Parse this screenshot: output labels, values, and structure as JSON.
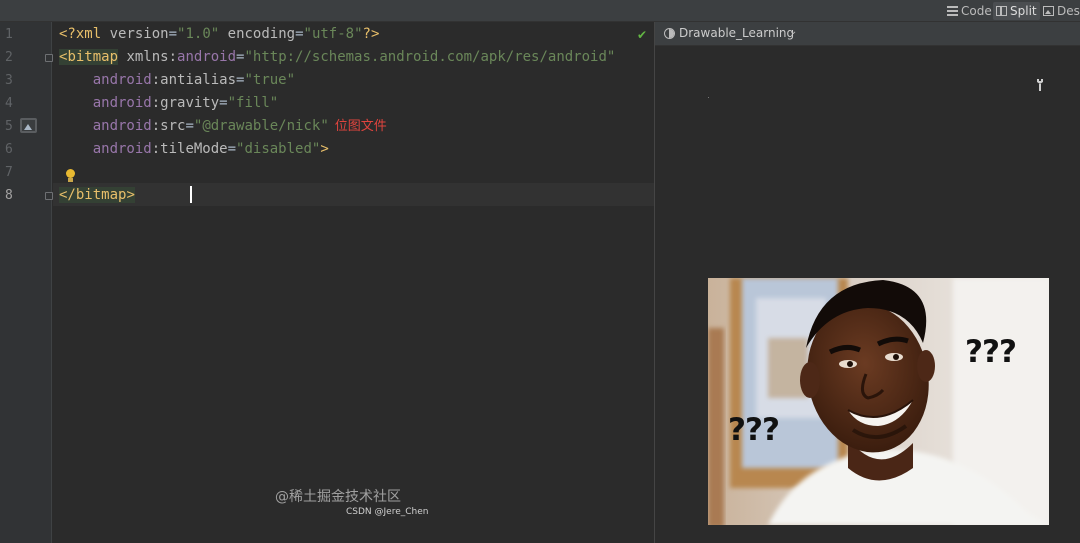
{
  "toolbar": {
    "code_label": "Code",
    "split_label": "Split",
    "design_label": "Desi",
    "active_view": "Split"
  },
  "gutter": {
    "line_numbers": [
      "1",
      "2",
      "3",
      "4",
      "5",
      "6",
      "7",
      "8"
    ],
    "current_line": "8"
  },
  "editor": {
    "line1": {
      "pi_open": "<?",
      "name": "xml",
      "attr1": "version",
      "eq": "=",
      "val1": "\"1.0\"",
      "attr2": "encoding",
      "val2": "\"utf-8\"",
      "pi_close": "?>"
    },
    "line2": {
      "open": "<",
      "tag": "bitmap",
      "attr": "xmlns:",
      "ns": "android",
      "eq": "=",
      "val": "\"http://schemas.android.com/apk/res/android\""
    },
    "line3": {
      "ns": "android",
      "attr": ":antialias",
      "eq": "=",
      "val": "\"true\""
    },
    "line4": {
      "ns": "android",
      "attr": ":gravity",
      "eq": "=",
      "val": "\"fill\""
    },
    "line5": {
      "ns": "android",
      "attr": ":src",
      "eq": "=",
      "val": "\"@drawable/nick\"",
      "annotation": "位图文件"
    },
    "line6": {
      "ns": "android",
      "attr": ":tileMode",
      "eq": "=",
      "val": "\"disabled\"",
      "close": ">"
    },
    "line8": {
      "open": "</",
      "tag": "bitmap",
      "close": ">"
    }
  },
  "preview": {
    "theme_name": "Drawable_Learning",
    "image_alt": "nick.png — man looking confused",
    "overlay_left": "???",
    "overlay_right": "???"
  },
  "watermarks": {
    "juejin": "@稀土掘金技术社区",
    "csdn": "CSDN @Jere_Chen"
  },
  "colors": {
    "editor_bg": "#2b2b2b",
    "gutter_bg": "#313335",
    "tag": "#e8bf6a",
    "namespace": "#9876aa",
    "attribute": "#bababa",
    "string": "#6a8759",
    "annotation_red": "#e0443e",
    "check_green": "#62b543"
  }
}
